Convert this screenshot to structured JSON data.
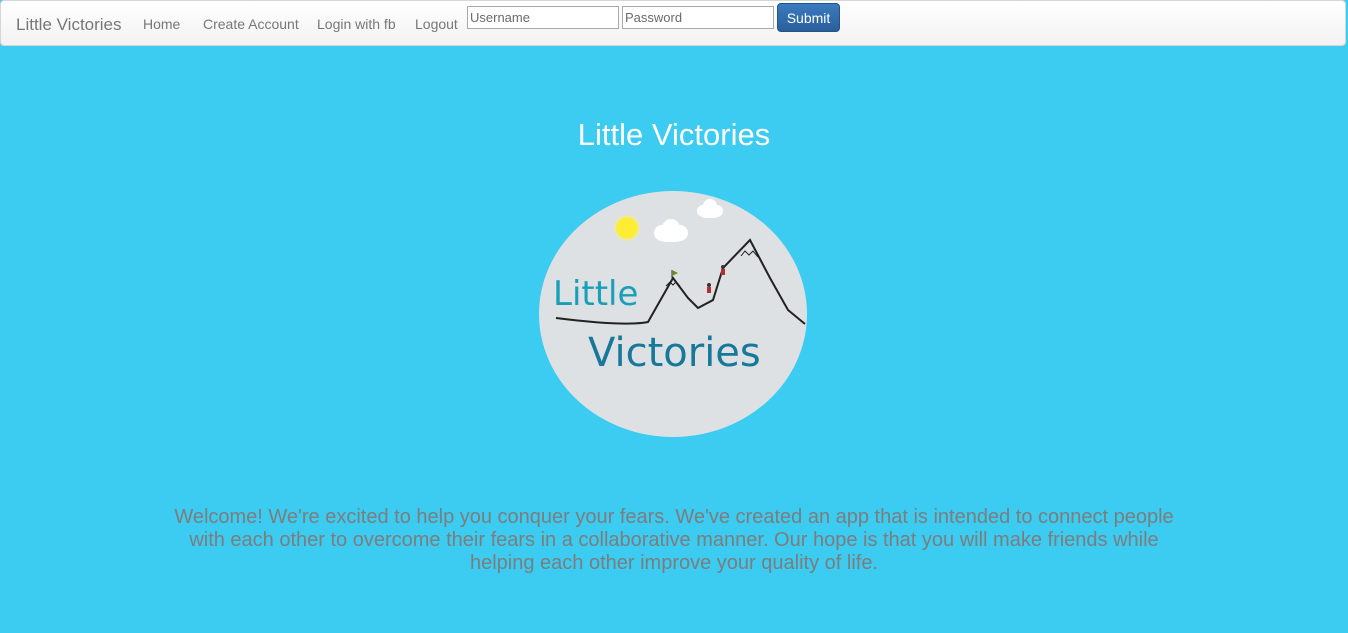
{
  "navbar": {
    "brand": "Little Victories",
    "links": [
      "Home",
      "Create Account",
      "Login with fb",
      "Logout"
    ],
    "username_placeholder": "Username",
    "password_placeholder": "Password",
    "submit_label": "Submit"
  },
  "hero": {
    "title": "Little Victories",
    "logo": {
      "word1": "Little",
      "word2": "Victories",
      "text_color": "#1a9fb8",
      "circle_color": "#dde1e4",
      "sun_color": "#ffe81a"
    }
  },
  "welcome_text": "Welcome! We're excited to help you conquer your fears. We've created an app that is intended to connect people with each other to overcome their fears in a collaborative manner. Our hope is that you will make friends while helping each other improve your quality of life.",
  "colors": {
    "background": "#3ccbf1",
    "submit": "#2f6aad",
    "welcome_text": "#7d7d7d"
  }
}
